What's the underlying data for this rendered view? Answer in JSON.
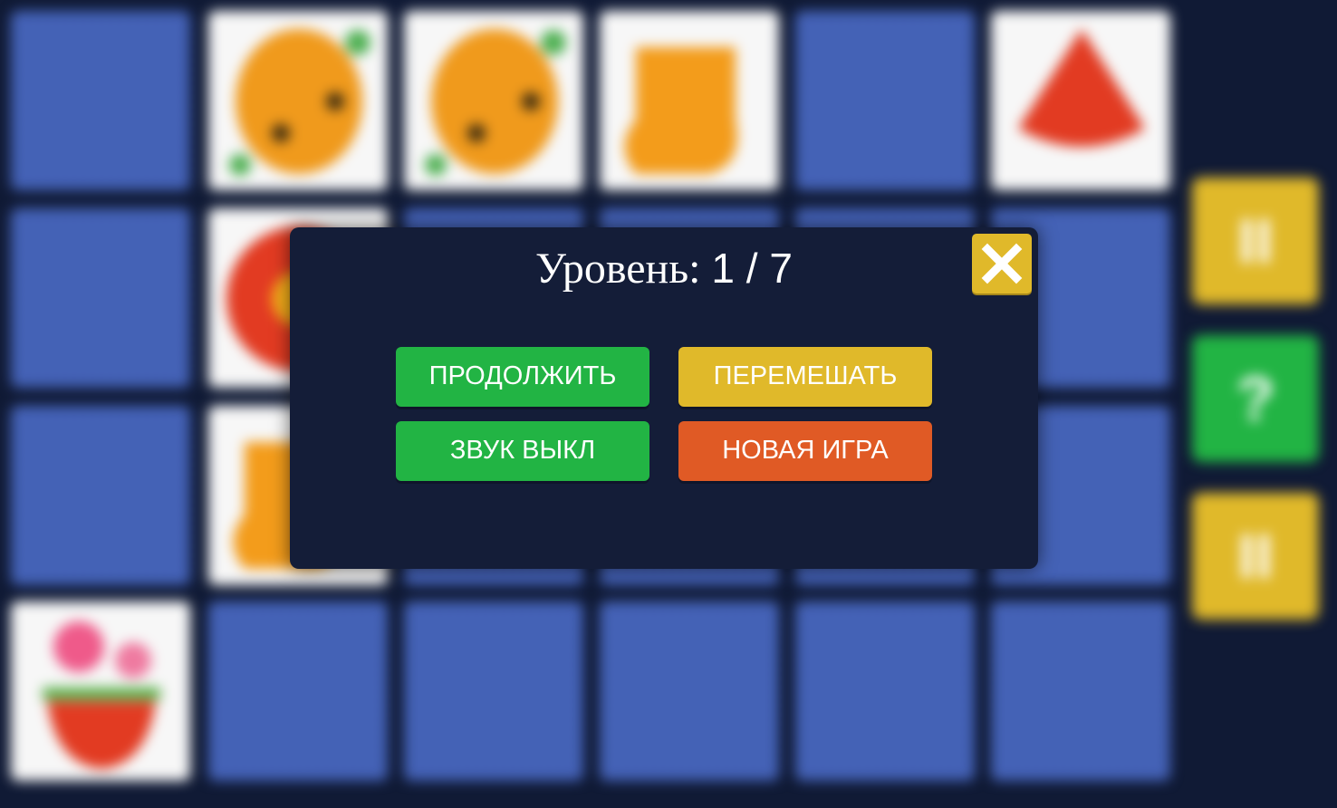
{
  "modal": {
    "title_label": "Уровень:",
    "title_value": "1 / 7",
    "close_icon": "close-x-icon",
    "buttons": {
      "continue": "ПРОДОЛЖИТЬ",
      "shuffle": "ПЕРЕМЕШАТЬ",
      "sound": "ЗВУК ВЫКЛ",
      "new_game": "НОВАЯ ИГРА"
    }
  },
  "side_panel": {
    "top_button": "II",
    "help_button": "?",
    "bottom_button": "II"
  },
  "colors": {
    "card_back": "#4563b8",
    "modal_bg": "#141d38",
    "accent_yellow": "#e0b92a",
    "accent_green": "#22b444",
    "accent_orange": "#e05a25"
  }
}
